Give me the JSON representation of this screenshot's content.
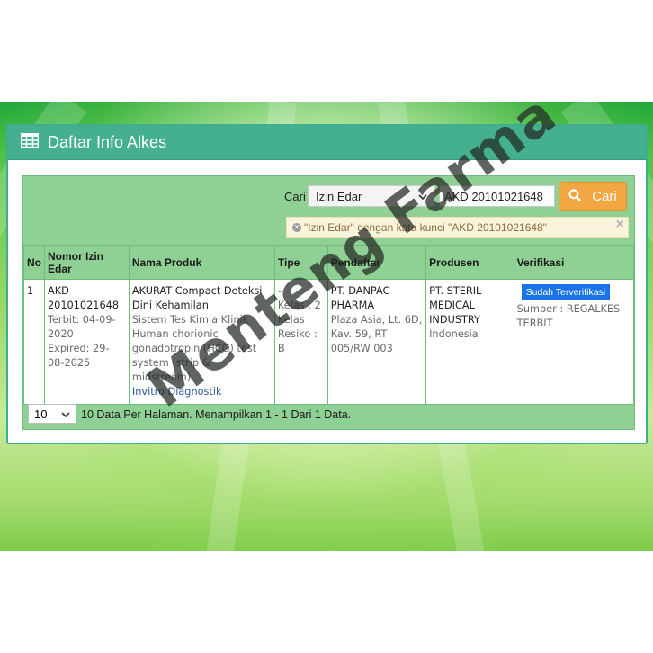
{
  "colors": {
    "header": "#45b08f",
    "content_bg": "#8fd094",
    "search_button": "#f2a742",
    "badge": "#1a73e8",
    "alert_bg": "#fbf4dc",
    "alert_text": "#8a6d3b"
  },
  "panel": {
    "title": "Daftar Info Alkes",
    "icon": "table-icon"
  },
  "search": {
    "label": "Cari",
    "field_selected": "Izin Edar",
    "input_value": "AKD 20101021648",
    "button_label": "Cari",
    "button_icon": "search-icon"
  },
  "alert": {
    "text": "\"Izin Edar\" dengan kata kunci \"AKD 20101021648\"",
    "close": "×"
  },
  "table": {
    "headers": [
      "No",
      "Nomor Izin Edar",
      "Nama Produk",
      "Tipe",
      "Pendaftar",
      "Produsen",
      "Verifikasi"
    ],
    "rows": [
      {
        "no": "1",
        "nomor": "AKD 20101021648",
        "terbit": "Terbit: 04-09-2020",
        "expired": "Expired: 29-08-2025",
        "nama": "AKURAT Compact Deteksi Dini Kehamilan",
        "deskripsi": "Sistem Tes Kimia Klinik Human chorionic gonadotropin (HCG) test system (strip & midstream)",
        "kategori": "Invitro Diagnostik",
        "tipe": "-",
        "kelas": "Kelas : 2 Kelas Resiko : B",
        "pendaftar": "PT. DANPAC PHARMA",
        "pendaftar_alamat": "Plaza Asia, Lt. 6D, Kav. 59, RT 005/RW 003",
        "produsen": "PT. STERIL MEDICAL INDUSTRY",
        "produsen_negara": "Indonesia",
        "verifikasi_badge": "Sudah Terverifikasi",
        "sumber": "Sumber : REGALKES TERBIT"
      }
    ]
  },
  "footer": {
    "per_page": "10",
    "text": "10 Data Per Halaman. Menampilkan 1 - 1 Dari 1 Data."
  },
  "watermark": "Menteng Farma"
}
